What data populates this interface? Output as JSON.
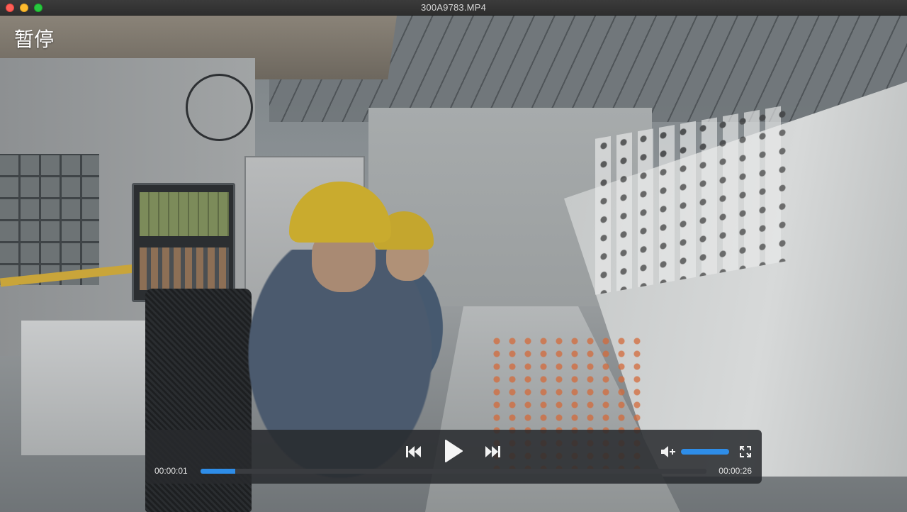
{
  "window": {
    "title": "300A9783.MP4"
  },
  "overlay": {
    "status_text": "暂停"
  },
  "controls": {
    "current_time": "00:00:01",
    "duration": "00:00:26",
    "progress": 0.068,
    "volume": 1.0,
    "icons": {
      "prev": "skip-back-icon",
      "play": "play-icon",
      "next": "skip-forward-icon",
      "volume": "volume-icon",
      "fullscreen": "fullscreen-icon"
    }
  },
  "colors": {
    "accent": "#2e8de8",
    "close": "#fe5f57",
    "minimize": "#febc2e",
    "maximize": "#28c840"
  }
}
